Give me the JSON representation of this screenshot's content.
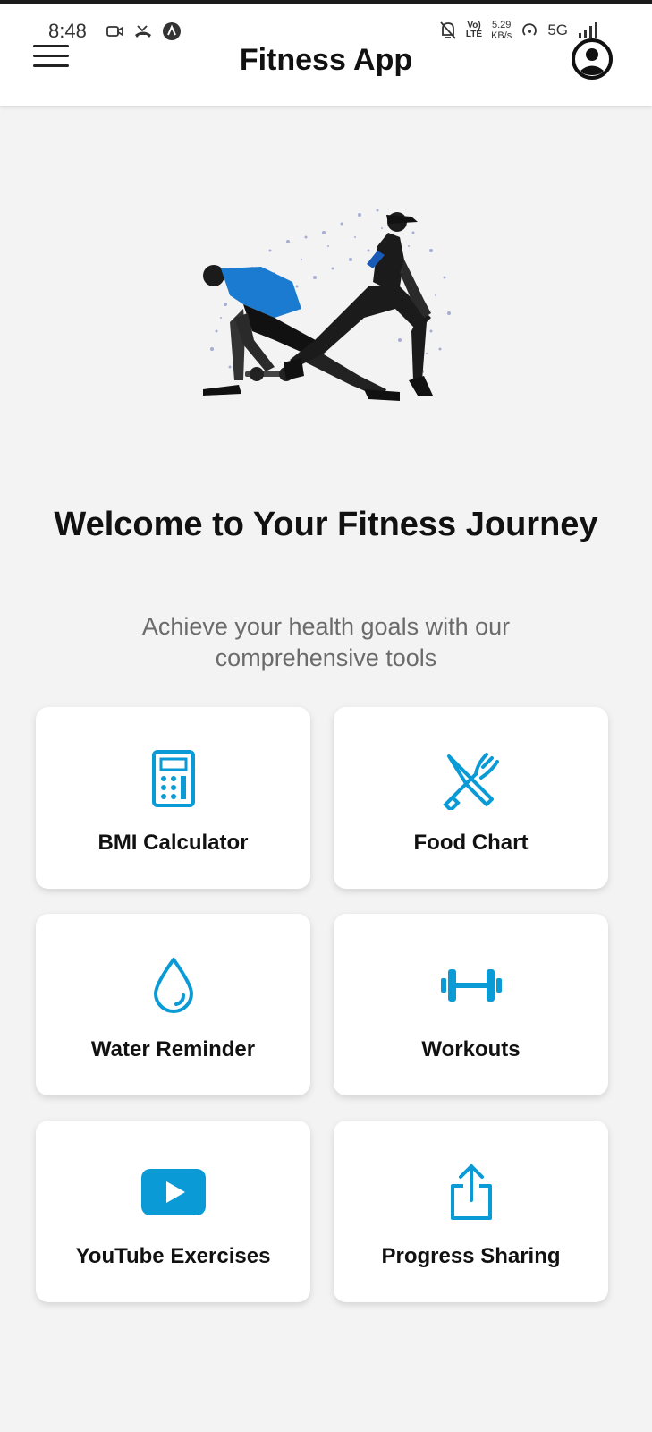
{
  "status_bar": {
    "time": "8:48",
    "volte_top": "Vo)",
    "volte_bottom": "LTE",
    "speed_value": "5.29",
    "speed_unit": "KB/s",
    "network": "5G"
  },
  "header": {
    "title": "Fitness App"
  },
  "hero": {
    "title": "Welcome to Your Fitness Journey",
    "subtitle": "Achieve your health goals with our comprehensive tools"
  },
  "features": [
    {
      "label": "BMI Calculator",
      "icon": "calculator-icon"
    },
    {
      "label": "Food Chart",
      "icon": "utensils-icon"
    },
    {
      "label": "Water Reminder",
      "icon": "water-drop-icon"
    },
    {
      "label": "Workouts",
      "icon": "dumbbell-icon"
    },
    {
      "label": "YouTube Exercises",
      "icon": "youtube-play-icon"
    },
    {
      "label": "Progress Sharing",
      "icon": "share-icon"
    }
  ],
  "colors": {
    "accent": "#0a9ad6",
    "background": "#f3f3f3",
    "card": "#ffffff",
    "text": "#111111",
    "subtext": "#6b6b6b"
  }
}
